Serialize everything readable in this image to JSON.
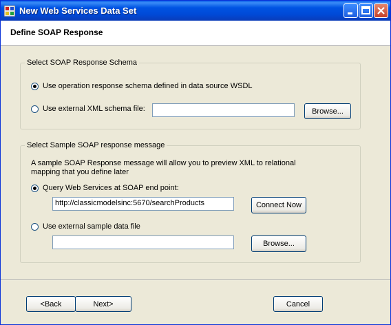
{
  "window": {
    "title": "New Web Services Data Set"
  },
  "header": {
    "title": "Define SOAP Response"
  },
  "schema_group": {
    "legend": "Select SOAP Response Schema",
    "option_operation": "Use operation response schema defined in data source WSDL",
    "option_external": "Use external XML schema file:",
    "external_file_value": "",
    "browse_label": "Browse..."
  },
  "sample_group": {
    "legend": "Select Sample SOAP response message",
    "description_line1": "A sample SOAP Response message will allow you to preview XML to relational",
    "description_line2": "mapping that you define later",
    "option_query": "Query Web Services at SOAP end point:",
    "endpoint_value": "http://classicmodelsinc:5670/searchProducts",
    "connect_label": "Connect Now",
    "option_external_file": "Use external sample data file",
    "sample_file_value": "",
    "browse_label": "Browse..."
  },
  "footer": {
    "back_label": "<Back",
    "next_label": "Next>",
    "cancel_label": "Cancel"
  }
}
